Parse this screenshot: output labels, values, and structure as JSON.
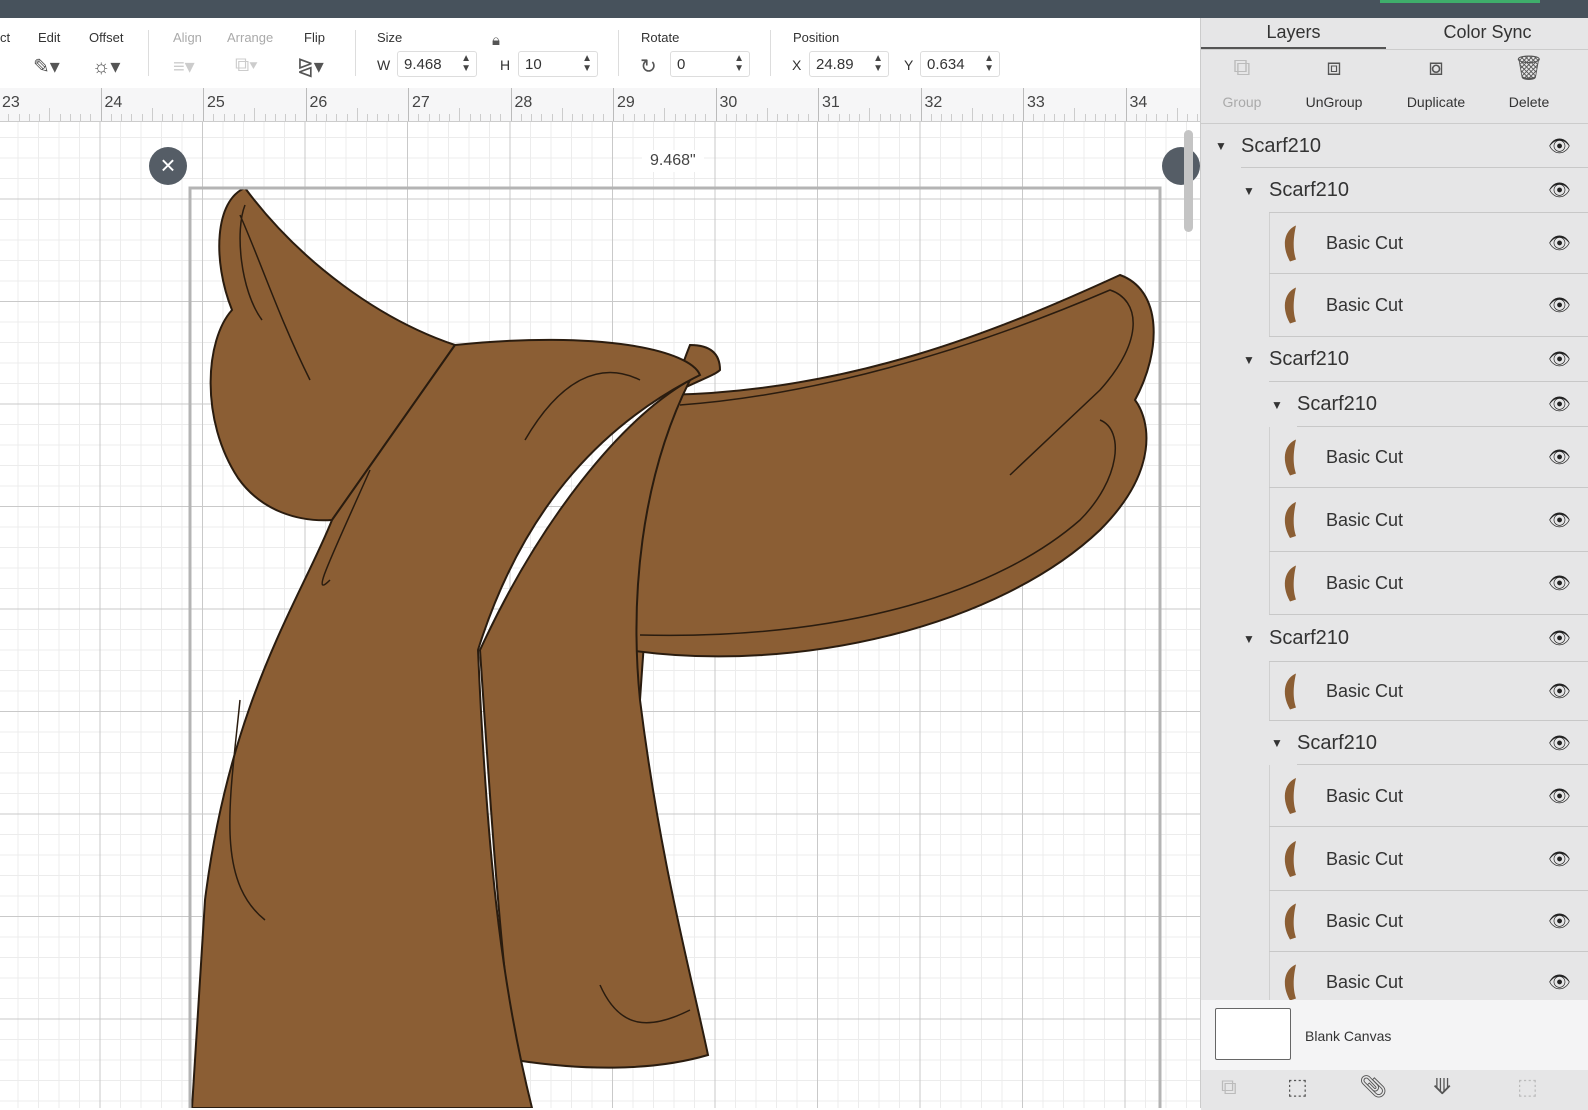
{
  "toolbar": {
    "select_partial": "ct",
    "edit": "Edit",
    "offset": "Offset",
    "align": "Align",
    "arrange": "Arrange",
    "flip": "Flip",
    "size": "Size",
    "w_label": "W",
    "w_value": "9.468",
    "h_label": "H",
    "h_value": "10",
    "rotate": "Rotate",
    "rotate_value": "0",
    "position": "Position",
    "x_label": "X",
    "x_value": "24.89",
    "y_label": "Y",
    "y_value": "0.634"
  },
  "ruler": [
    "23",
    "24",
    "25",
    "26",
    "27",
    "28",
    "29",
    "30",
    "31",
    "32",
    "33",
    "34"
  ],
  "canvas": {
    "width_label": "9.468\"",
    "fill_color": "#8b5e34",
    "stroke_color": "#2a1c0f"
  },
  "panel": {
    "tabs": [
      "Layers",
      "Color Sync"
    ],
    "actions": [
      {
        "label": "Group",
        "enabled": false
      },
      {
        "label": "UnGroup",
        "enabled": true
      },
      {
        "label": "Duplicate",
        "enabled": true
      },
      {
        "label": "Delete",
        "enabled": true
      }
    ],
    "layers": [
      {
        "type": "group",
        "level": 0,
        "name": "Scarf210"
      },
      {
        "type": "group",
        "level": 1,
        "name": "Scarf210"
      },
      {
        "type": "cut",
        "name": "Basic Cut"
      },
      {
        "type": "cut",
        "name": "Basic Cut"
      },
      {
        "type": "group",
        "level": 1,
        "name": "Scarf210"
      },
      {
        "type": "group",
        "level": 2,
        "name": "Scarf210"
      },
      {
        "type": "cut",
        "name": "Basic Cut"
      },
      {
        "type": "cut",
        "name": "Basic Cut"
      },
      {
        "type": "cut",
        "name": "Basic Cut"
      },
      {
        "type": "group",
        "level": 1,
        "name": "Scarf210"
      },
      {
        "type": "cut",
        "name": "Basic Cut"
      },
      {
        "type": "group",
        "level": 2,
        "name": "Scarf210"
      },
      {
        "type": "cut",
        "name": "Basic Cut"
      },
      {
        "type": "cut",
        "name": "Basic Cut"
      },
      {
        "type": "cut",
        "name": "Basic Cut"
      },
      {
        "type": "cut",
        "name": "Basic Cut"
      }
    ],
    "blank_canvas": "Blank Canvas"
  }
}
